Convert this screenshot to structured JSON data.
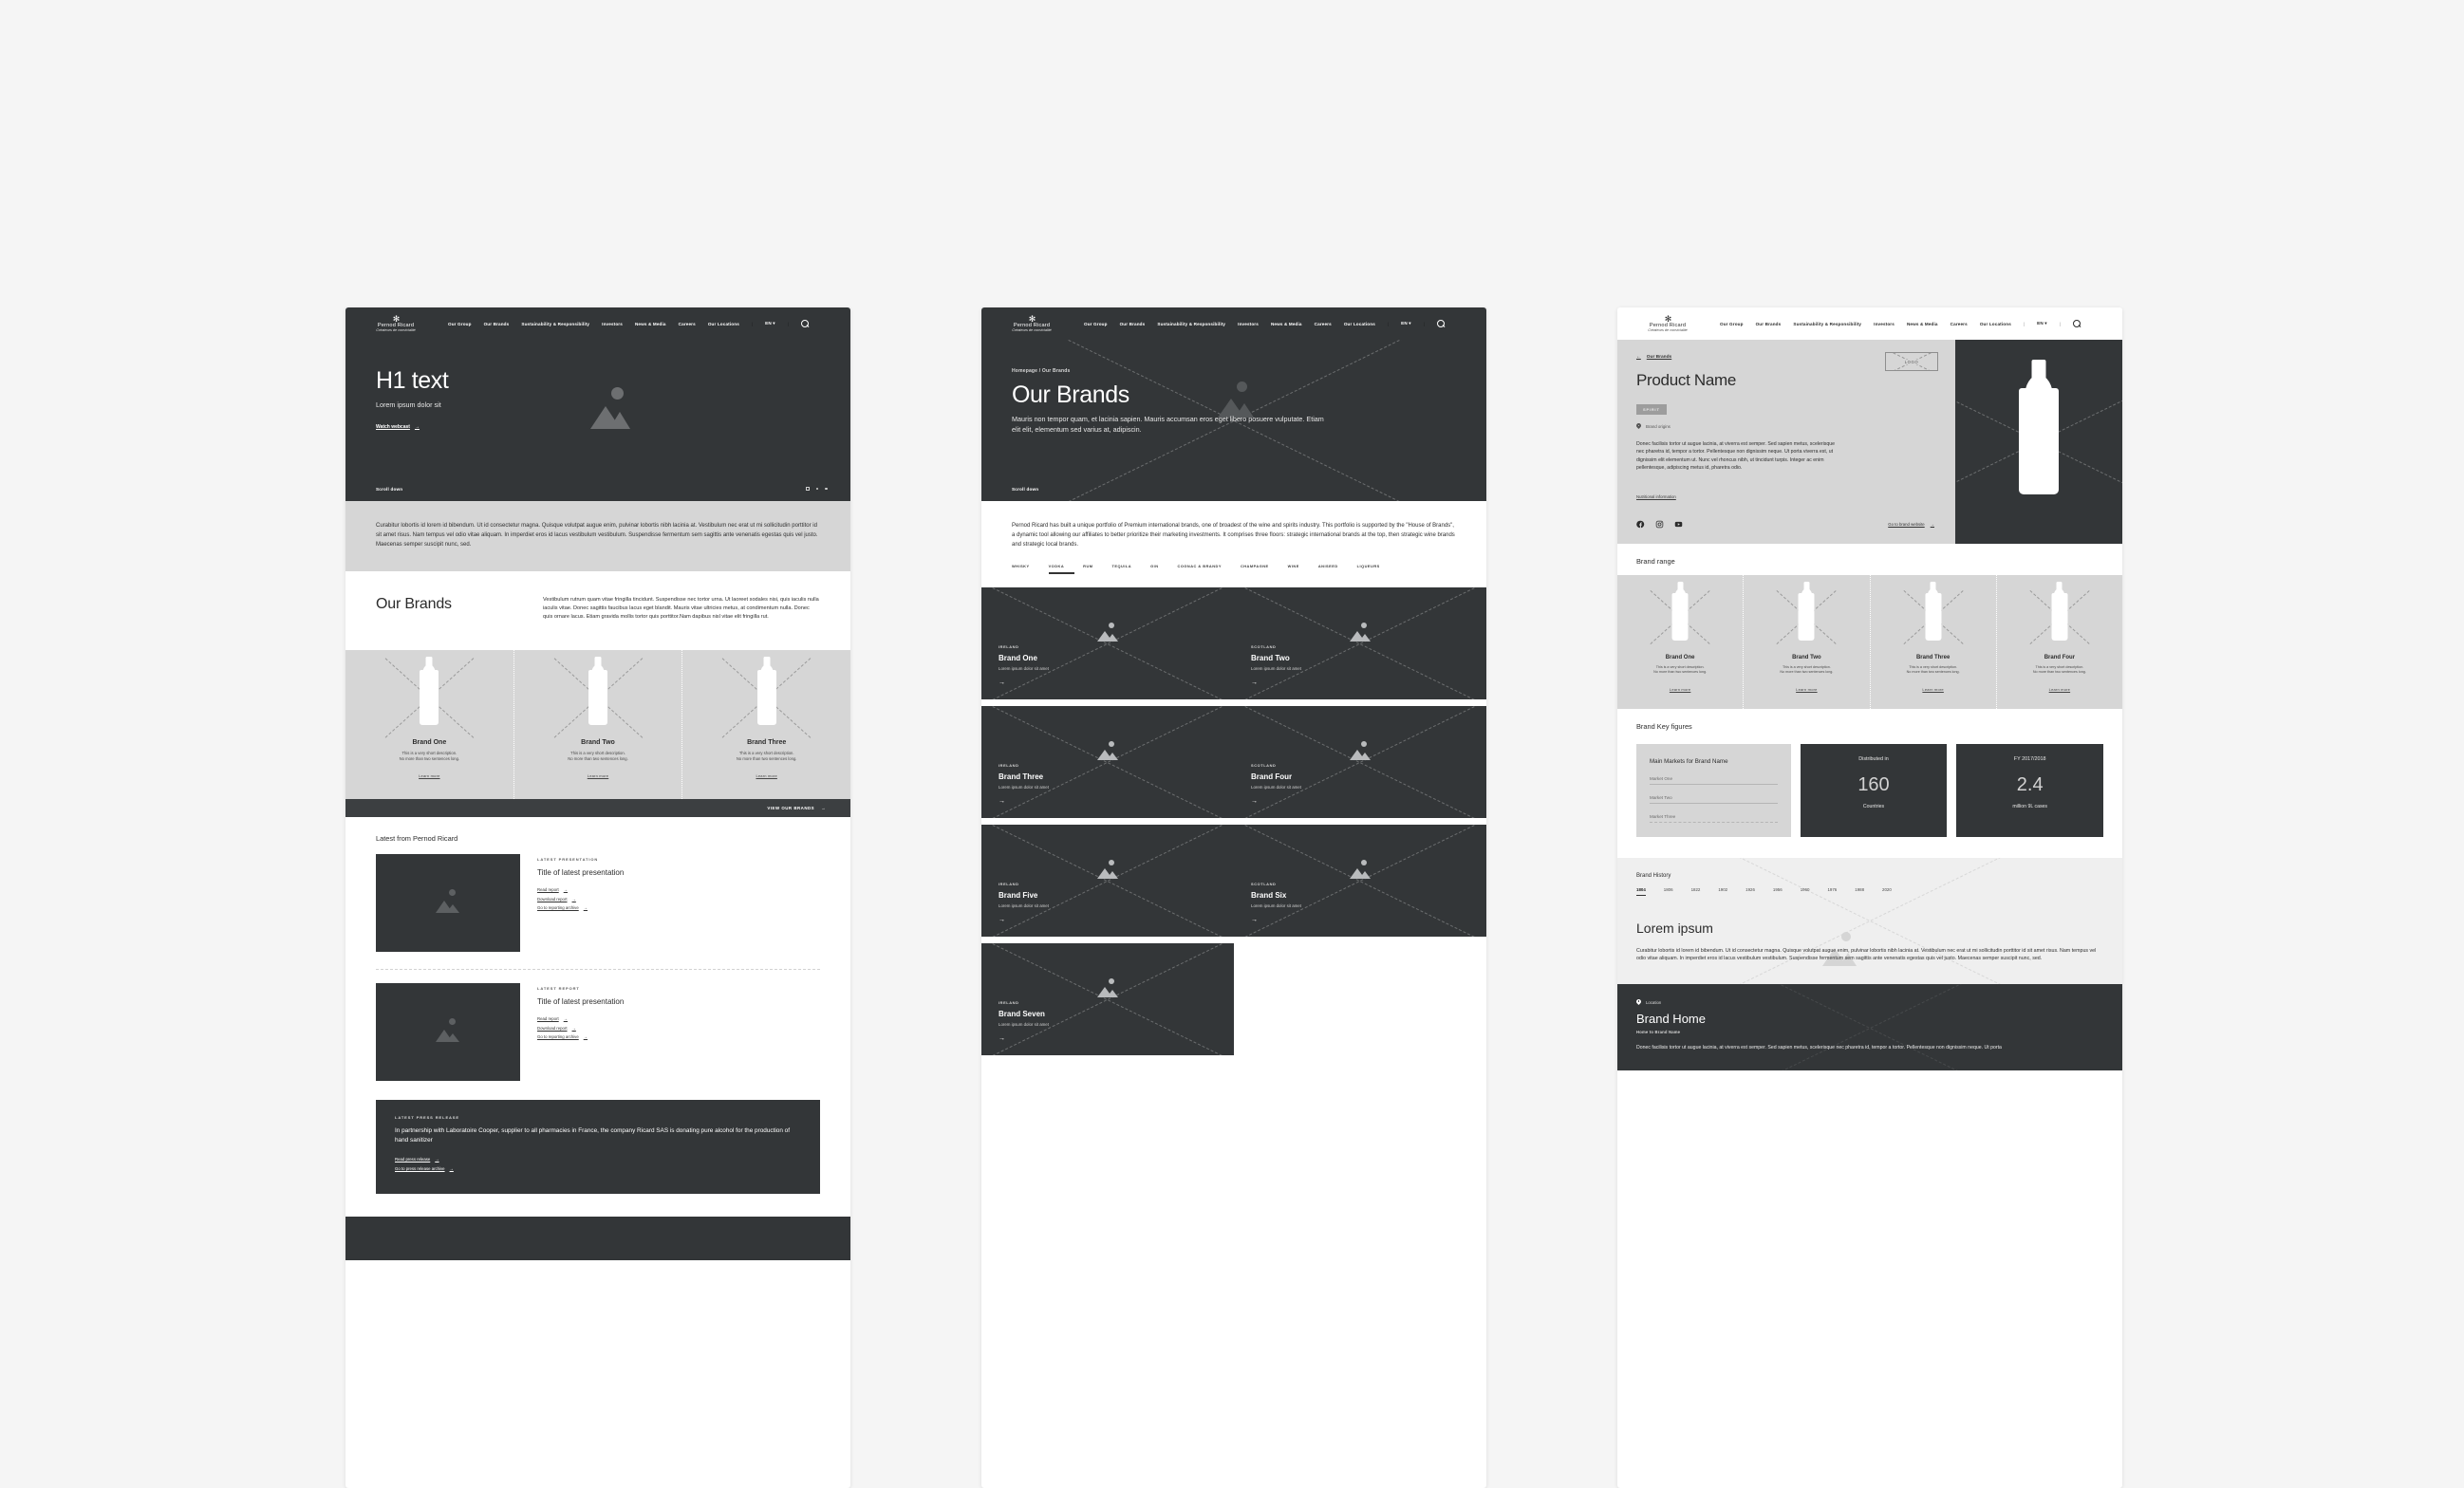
{
  "brand": {
    "logo_mark": "✻",
    "name": "Pernod Ricard",
    "tagline": "Créateurs de convivialité"
  },
  "nav": {
    "items": [
      "Our Group",
      "Our Brands",
      "Sustainability & Responsibility",
      "Investors",
      "News & Media",
      "Careers",
      "Our Locations"
    ],
    "separator": "|",
    "language": "EN",
    "lang_caret": "▾",
    "search_icon": "search-icon"
  },
  "home": {
    "hero": {
      "h1": "H1 text",
      "subtitle": "Lorem ipsum dolor sit",
      "cta": "Watch webcast",
      "cta_arrow": "→",
      "scroll_label": "Scroll down"
    },
    "intro": "Curabitur lobortis id lorem id bibendum. Ut id consectetur magna. Quisque volutpat augue enim, pulvinar lobortis nibh lacinia at. Vestibulum nec erat ut mi sollicitudin porttitor id sit amet risus. Nam tempus vel odio vitae aliquam. In imperdiet eros id lacus vestibulum vestibulum. Suspendisse fermentum sem sagittis ante venenatis egestas quis vel justo. Maecenas semper suscipit nunc, sed.",
    "brands_section": {
      "title": "Our Brands",
      "copy": "Vestibulum rutrum quam vitae fringilla tincidunt. Suspendisse nec tortor urna. Ut laoreet sodales nisi, quis iaculis nulla iaculis vitae. Donec sagittis faucibus lacus eget blandit. Mauris vitae ultricies metus, at condimentum nulla. Donec quis ornare lacus. Etiam gravida mollis tortor quis porttitor.Nam dapibus nisl vitae elit fringilla rut.",
      "cards": [
        {
          "name": "Brand One",
          "desc_l1": "This is a very short description.",
          "desc_l2": "No more than two sentences long.",
          "link": "Learn more"
        },
        {
          "name": "Brand Two",
          "desc_l1": "This is a very short description.",
          "desc_l2": "No more than two sentences long.",
          "link": "Learn more"
        },
        {
          "name": "Brand Three",
          "desc_l1": "This is a very short description.",
          "desc_l2": "No more than two sentences long.",
          "link": "Learn more"
        }
      ],
      "view_all": "VIEW OUR BRANDS",
      "view_all_arrow": "→"
    },
    "latest": {
      "title": "Latest from Pernod Ricard",
      "items": [
        {
          "eyebrow": "LATEST PRESENTATION",
          "title": "Title of latest presentation",
          "links": [
            "Read report",
            "Download report",
            "Go to reporting archive"
          ]
        },
        {
          "eyebrow": "LATEST REPORT",
          "title": "Title of latest presentation",
          "links": [
            "Read report",
            "Download report",
            "Go to reporting archive"
          ]
        }
      ],
      "arrow": "→"
    },
    "press": {
      "eyebrow": "LATEST PRESS RELEASE",
      "title": "In partnership with Laboratoire Cooper, supplier to all pharmacies in France, the company Ricard SAS is donating pure alcohol for the production of hand sanitizer",
      "links": [
        "Read press release",
        "Go to press release archive"
      ],
      "arrow": "→"
    }
  },
  "brands_page": {
    "hero": {
      "breadcrumb": "Homepage / Our Brands",
      "h1": "Our Brands",
      "subtitle": "Mauris non tempor quam, et lacinia sapien. Mauris accumsan eros eget libero posuere vulputate. Etiam elit elit, elementum sed varius at, adipiscin.",
      "scroll_label": "Scroll down"
    },
    "intro": "Pernod Ricard has built a unique portfolio of Premium international brands, one of broadest of the wine and spirits industry. This portfolio is supported by the \"House of Brands\", a dynamic tool allowing our affiliates to better prioritize their marketing investments. It comprises three floors: strategic international brands at the top, then strategic wine brands and strategic local brands.",
    "categories": [
      "WHISKY",
      "VODKA",
      "RUM",
      "TEQUILA",
      "GIN",
      "COGNAC & BRANDY",
      "CHAMPAGNE",
      "WINE",
      "ANISEED",
      "LIQUEURS"
    ],
    "active_category": "VODKA",
    "tiles": [
      {
        "country": "IRELAND",
        "name": "Brand One",
        "sub": "Lorem ipsum dolor sit amet",
        "arrow": "→"
      },
      {
        "country": "SCOTLAND",
        "name": "Brand Two",
        "sub": "Lorem ipsum dolor sit amet",
        "arrow": "→"
      },
      {
        "country": "IRELAND",
        "name": "Brand Three",
        "sub": "Lorem ipsum dolor sit amet",
        "arrow": "→"
      },
      {
        "country": "SCOTLAND",
        "name": "Brand Four",
        "sub": "Lorem ipsum dolor sit amet",
        "arrow": "→"
      },
      {
        "country": "IRELAND",
        "name": "Brand Five",
        "sub": "Lorem ipsum dolor sit amet",
        "arrow": "→"
      },
      {
        "country": "SCOTLAND",
        "name": "Brand Six",
        "sub": "Lorem ipsum dolor sit amet",
        "arrow": "→"
      },
      {
        "country": "IRELAND",
        "name": "Brand Seven",
        "sub": "Lorem ipsum dolor sit amet",
        "arrow": "→"
      }
    ]
  },
  "product_page": {
    "back_label": "Our Brands",
    "back_arrow": "←",
    "logo_placeholder": "LOGO",
    "title": "Product Name",
    "badge": "SPIRIT",
    "origin_label": "Brand origins",
    "description": "Donec facilisis tortor ut augue lacinia, at viverra est semper. Sed sapien metus, scelerisque nec pharetra id, tempor a tortor. Pellentesque non dignissim neque. Ut porta viverra est, ut dignissim elit elementum ut. Nunc vel rhoncus nibh, ut tincidunt turpis. Integer ac enim pellentesque, adipiscing metus id, pharetra odio.",
    "nutritional_link": "Nutritional information",
    "social": [
      "facebook-icon",
      "instagram-icon",
      "youtube-icon"
    ],
    "website_link": "Go to brand website",
    "website_arrow": "→",
    "range": {
      "title": "Brand range",
      "cards": [
        {
          "name": "Brand One",
          "desc_l1": "This is a very short description.",
          "desc_l2": "No more than two sentences long.",
          "link": "Learn more"
        },
        {
          "name": "Brand Two",
          "desc_l1": "This is a very short description.",
          "desc_l2": "No more than two sentences long.",
          "link": "Learn more"
        },
        {
          "name": "Brand Three",
          "desc_l1": "This is a very short description.",
          "desc_l2": "No more than two sentences long.",
          "link": "Learn more"
        },
        {
          "name": "Brand Four",
          "desc_l1": "This is a very short description.",
          "desc_l2": "No more than two sentences long.",
          "link": "Learn more"
        }
      ]
    },
    "key_figures": {
      "title": "Brand Key figures",
      "markets_card": {
        "title": "Main Markets for Brand Name",
        "markets": [
          "Market One",
          "Market Two",
          "Market Three"
        ]
      },
      "stats": [
        {
          "label": "Distributed in",
          "value": "160",
          "unit": "Countries"
        },
        {
          "label": "FY 2017/2018",
          "value": "2.4",
          "unit": "million 9L cases"
        }
      ]
    },
    "history": {
      "title": "Brand History",
      "years": [
        "1804",
        "1806",
        "1822",
        "1902",
        "1926",
        "1956",
        "1960",
        "1976",
        "1988",
        "2020"
      ],
      "active_year": "1804",
      "heading": "Lorem ipsum",
      "copy": "Curabitur lobortis id lorem id bibendum. Ut id consectetur magna. Quisque volutpat augue enim, pulvinar lobortis nibh lacinia at. Vestibulum nec erat ut mi sollicitudin porttitor id sit amet risus. Nam tempus vel odio vitae aliquam. In imperdiet eros id lacus vestibulum vestibulum. Suspendisse fermentum sem sagittis ante venenatis egestas quis vel justo. Maecenas semper suscipit nunc, sed."
    },
    "brand_home": {
      "pin_label": "Location",
      "title": "Brand Home",
      "subtitle": "Home to Brand Name",
      "copy": "Donec facilisis tortor ut augue lacinia, at viverra est semper. Sed sapien metus, scelerisque nec pharetra id, tempor a tortor. Pellentesque non dignissim neque. Ut porta"
    }
  },
  "colors": {
    "dark": "#333638",
    "grey_band": "#d6d6d6",
    "page_bg": "#f5f5f5"
  }
}
